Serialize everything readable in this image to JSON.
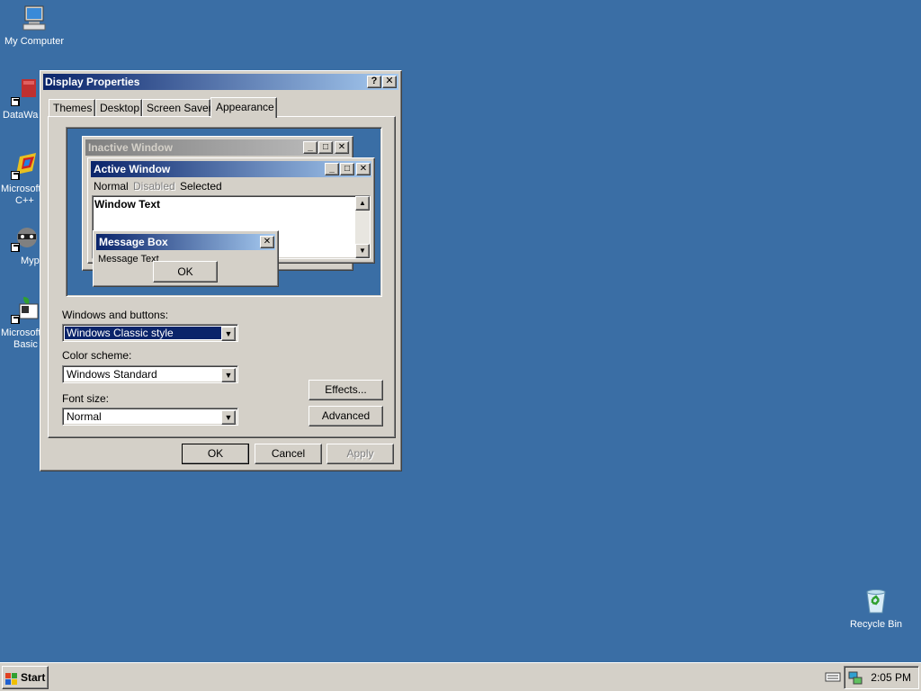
{
  "desktop": {
    "icons": [
      {
        "label": "My Computer"
      },
      {
        "label": "DataWa"
      },
      {
        "label": "Microsoft",
        "label2": "C++"
      },
      {
        "label": "Myp"
      },
      {
        "label": "Microsoft",
        "label2": "Basic"
      },
      {
        "label": "Recycle Bin"
      }
    ]
  },
  "dialog": {
    "title": "Display Properties",
    "help_glyph": "?",
    "close_glyph": "✕",
    "tabs": [
      {
        "label": "Themes"
      },
      {
        "label": "Desktop"
      },
      {
        "label": "Screen Saver"
      },
      {
        "label": "Appearance"
      }
    ],
    "preview": {
      "inactive_title": "Inactive Window",
      "active_title": "Active Window",
      "menu": {
        "normal": "Normal",
        "disabled": "Disabled",
        "selected": "Selected"
      },
      "window_text": "Window Text",
      "message_box_title": "Message Box",
      "message_text": "Message Text",
      "ok": "OK"
    },
    "windows_and_buttons": {
      "label": "Windows and buttons:",
      "value": "Windows Classic style"
    },
    "color_scheme": {
      "label": "Color scheme:",
      "value": "Windows Standard"
    },
    "font_size": {
      "label": "Font size:",
      "value": "Normal"
    },
    "effects_button": "Effects...",
    "advanced_button": "Advanced",
    "ok_button": "OK",
    "cancel_button": "Cancel",
    "apply_button": "Apply"
  },
  "taskbar": {
    "start_label": "Start",
    "clock": "2:05 PM"
  },
  "colors": {
    "desktop": "#3a6ea5",
    "active_title_start": "#0a246a",
    "active_title_end": "#a6caf0",
    "face": "#d4d0c8"
  }
}
